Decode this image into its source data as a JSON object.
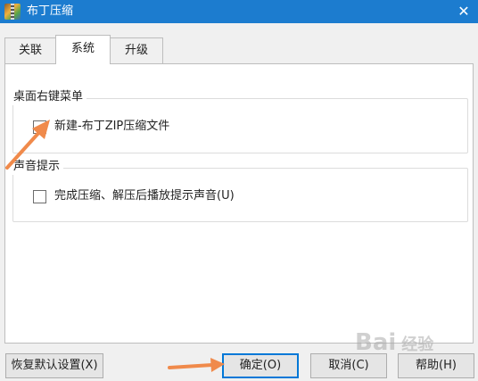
{
  "window": {
    "title": "布丁压缩",
    "close_symbol": "✕"
  },
  "tabs": [
    {
      "label": "关联"
    },
    {
      "label": "系统"
    },
    {
      "label": "升级"
    }
  ],
  "groups": {
    "context_menu": {
      "title": "桌面右键菜单",
      "checkbox_label": "新建-布丁ZIP压缩文件",
      "checked": false
    },
    "sound": {
      "title": "声音提示",
      "checkbox_label": "完成压缩、解压后播放提示声音(U)",
      "checked": false
    }
  },
  "buttons": {
    "restore_defaults": "恢复默认设置(X)",
    "ok": "确定(O)",
    "cancel": "取消(C)",
    "help": "帮助(H)"
  },
  "watermark": {
    "brand": "Bai",
    "site": "经验"
  },
  "colors": {
    "titlebar": "#1c7ccf",
    "annotation_arrow": "#f08a4b",
    "primary_border": "#0078d7"
  }
}
